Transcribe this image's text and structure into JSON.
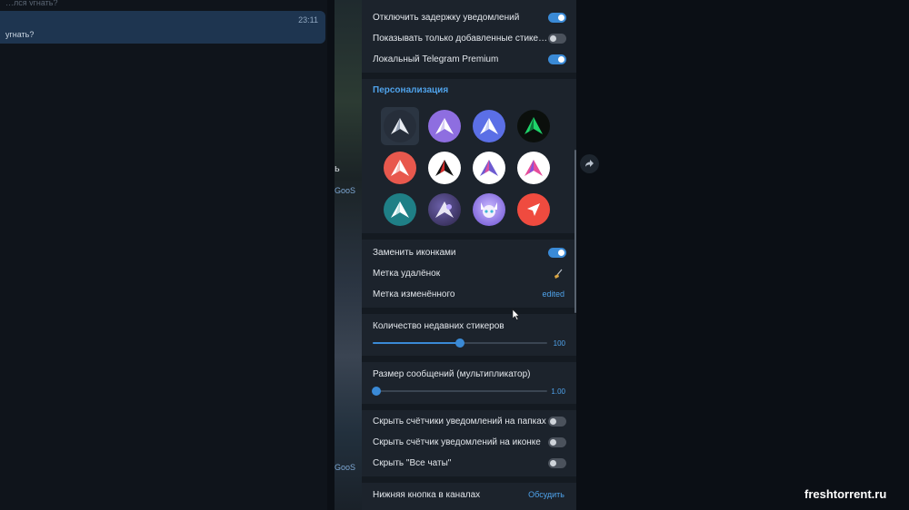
{
  "chat": {
    "top_fragment": "…лся угнать?",
    "message_time": "23:11",
    "message_text": "угнать?",
    "bg_labels": [
      "ь",
      "GooS",
      "GooS"
    ]
  },
  "settings": {
    "top_toggles": [
      {
        "label": "Отключить задержку уведомлений",
        "on": true
      },
      {
        "label": "Показывать только добавленные стике…",
        "on": false
      },
      {
        "label": "Локальный Telegram Premium",
        "on": true
      }
    ],
    "personalization_title": "Персонализация",
    "app_icons": [
      {
        "name": "icon-default",
        "style": "dark",
        "selected": true
      },
      {
        "name": "icon-purple",
        "style": "purple"
      },
      {
        "name": "icon-indigo",
        "style": "indigo"
      },
      {
        "name": "icon-green-glow",
        "style": "greenglow"
      },
      {
        "name": "icon-red",
        "style": "red"
      },
      {
        "name": "icon-black-red",
        "style": "blackred"
      },
      {
        "name": "icon-white-violet",
        "style": "whiteviolet"
      },
      {
        "name": "icon-pink",
        "style": "pink"
      },
      {
        "name": "icon-teal",
        "style": "teal"
      },
      {
        "name": "icon-anime-dark",
        "style": "anime1"
      },
      {
        "name": "icon-anime-violet",
        "style": "anime2"
      },
      {
        "name": "icon-red-arrow",
        "style": "redarrow"
      }
    ],
    "replace_with_icons": {
      "label": "Заменить иконками",
      "on": true
    },
    "deleted_mark": {
      "label": "Метка удалёнок",
      "icon": "broom-icon"
    },
    "edited_mark": {
      "label": "Метка изменённого",
      "value": "edited"
    },
    "recent_stickers": {
      "label": "Количество недавних стикеров",
      "value": "100",
      "fraction": 0.5
    },
    "message_size": {
      "label": "Размер сообщений (мультипликатор)",
      "value": "1.00",
      "fraction": 0.02
    },
    "bottom_toggles": [
      {
        "label": "Скрыть счётчики уведомлений на папках",
        "on": false
      },
      {
        "label": "Скрыть счётчик уведомлений на иконке",
        "on": false
      },
      {
        "label": "Скрыть \"Все чаты\"",
        "on": false
      }
    ],
    "channel_button": {
      "label": "Нижняя кнопка в каналах",
      "value": "Обсудить"
    }
  },
  "watermark": "freshtorrent.ru",
  "colors": {
    "accent": "#3a8ad6",
    "link": "#4fa2ea",
    "panel": "#1c232c"
  }
}
